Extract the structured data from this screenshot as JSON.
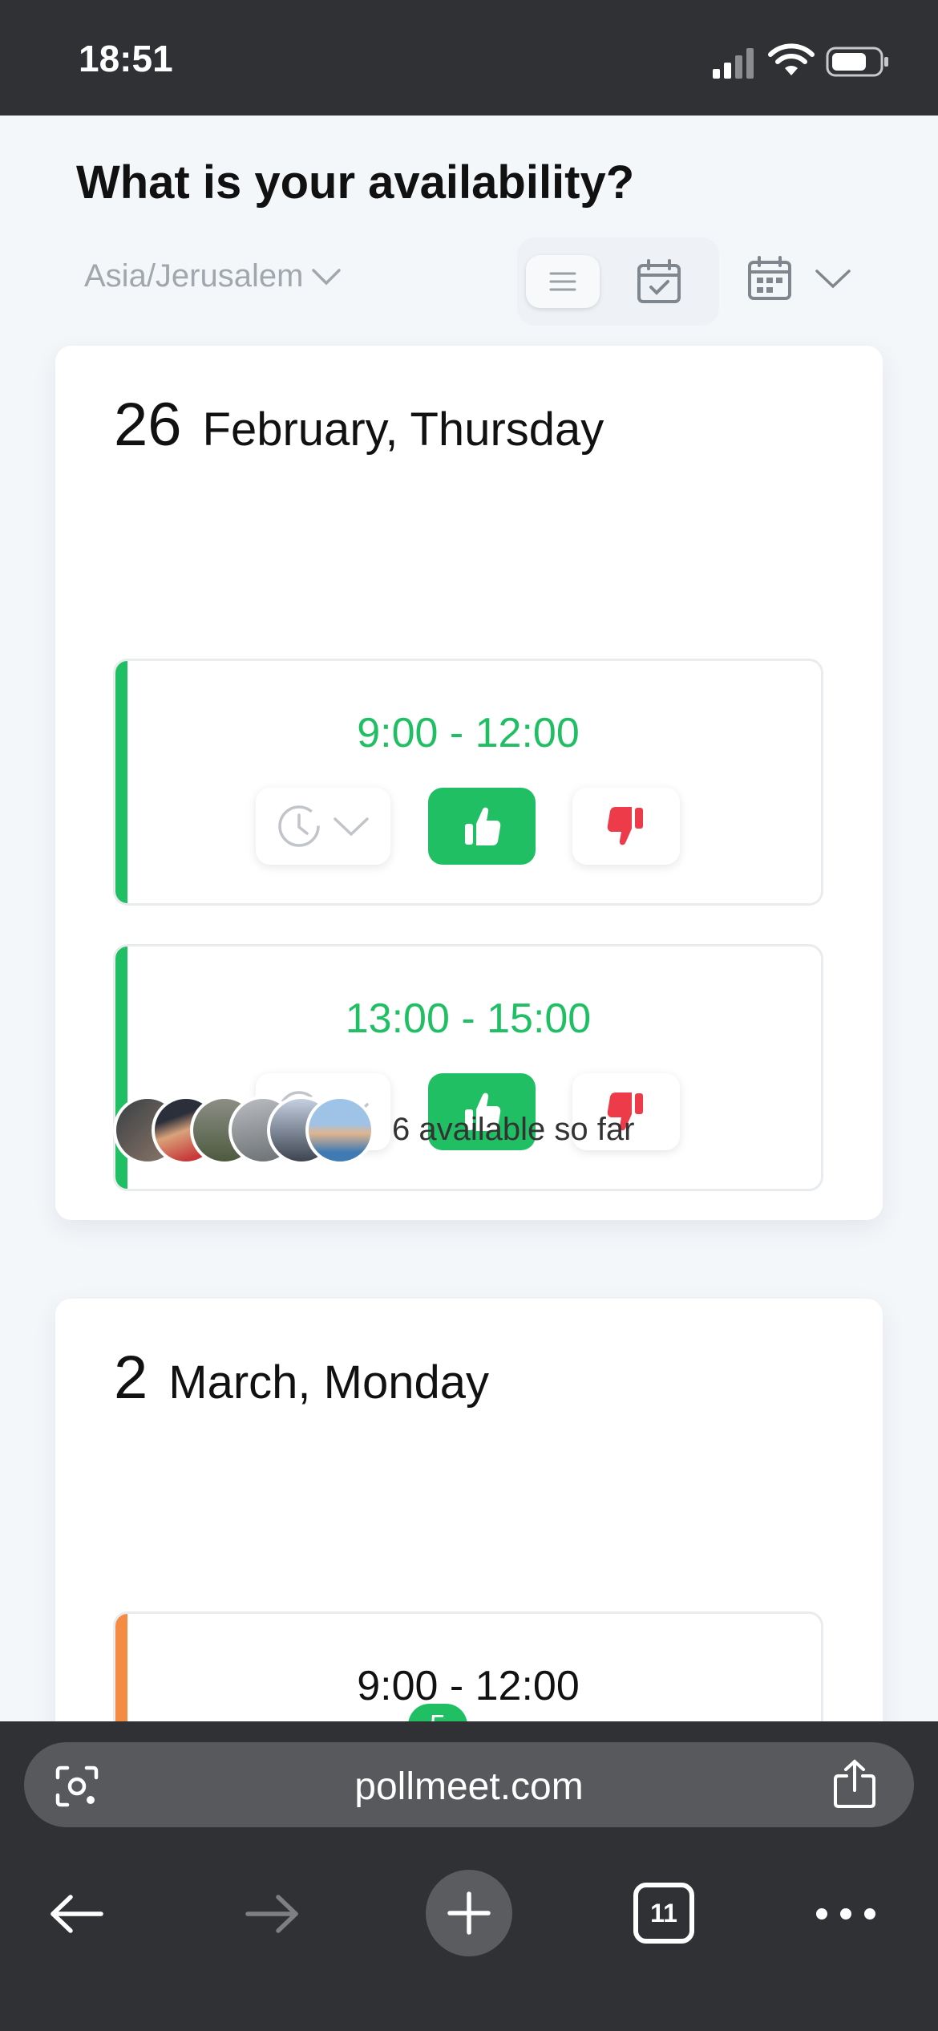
{
  "status": {
    "time": "18:51"
  },
  "page": {
    "title": "What is your availability?",
    "timezone": "Asia/Jerusalem"
  },
  "days": [
    {
      "day": "26",
      "rest": "February, Thursday",
      "slots": [
        {
          "time": "9:00 - 12:00",
          "status_color": "#21bf64",
          "vote": "yes"
        },
        {
          "time": "13:00 - 15:00",
          "status_color": "#21bf64",
          "vote": "yes"
        }
      ],
      "available_text": "6 available so far"
    },
    {
      "day": "2",
      "rest": "March, Monday",
      "slots": [
        {
          "time": "9:00 - 12:00",
          "status_color": "#f58b42",
          "vote": "none",
          "yes_count": "5"
        }
      ]
    }
  ],
  "browser": {
    "url": "pollmeet.com",
    "tab_count": "11"
  },
  "colors": {
    "accent_green": "#21bf64",
    "no_red": "#ee3b4a",
    "partial_orange": "#f58b42"
  }
}
